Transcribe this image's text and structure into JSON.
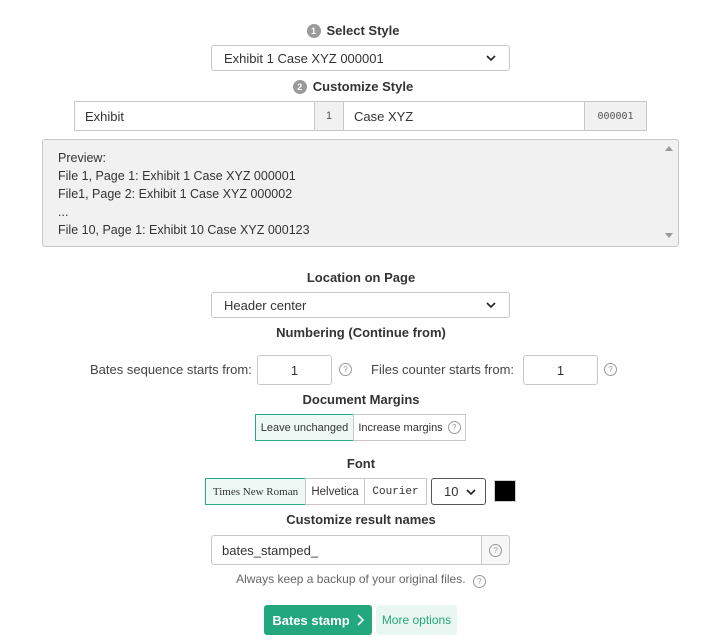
{
  "select_style": {
    "step": "1",
    "heading": "Select Style",
    "value": "Exhibit 1 Case XYZ 000001"
  },
  "customize_style": {
    "step": "2",
    "heading": "Customize Style",
    "prefix_value": "Exhibit",
    "number_addon": "1",
    "suffix_value": "Case XYZ",
    "counter_addon": "000001"
  },
  "preview": {
    "lines": [
      "Preview:",
      "File 1, Page 1: Exhibit 1 Case XYZ 000001",
      "File1, Page 2: Exhibit 1 Case XYZ 000002",
      "...",
      "File 10, Page 1: Exhibit 10 Case XYZ 000123"
    ]
  },
  "location": {
    "heading": "Location on Page",
    "value": "Header center"
  },
  "numbering": {
    "heading": "Numbering (Continue from)",
    "bates_label": "Bates sequence starts from:",
    "bates_value": "1",
    "files_label": "Files counter starts from:",
    "files_value": "1"
  },
  "margins": {
    "heading": "Document Margins",
    "leave_label": "Leave unchanged",
    "increase_label": "Increase margins"
  },
  "font": {
    "heading": "Font",
    "options": [
      "Times New Roman",
      "Helvetica",
      "Courier"
    ],
    "selected": "Times New Roman",
    "size": "10",
    "color": "#000000"
  },
  "result_names": {
    "heading": "Customize result names",
    "value": "bates_stamped_"
  },
  "backup_note": "Always keep a backup of your original files.",
  "actions": {
    "stamp_label": "Bates stamp",
    "more_label": "More options"
  },
  "icons": {
    "help": "?",
    "chevron": "chevron-down-icon",
    "arrow": "chevron-right-icon"
  },
  "colors": {
    "accent": "#23a87d",
    "active_border": "#2aa78a"
  }
}
